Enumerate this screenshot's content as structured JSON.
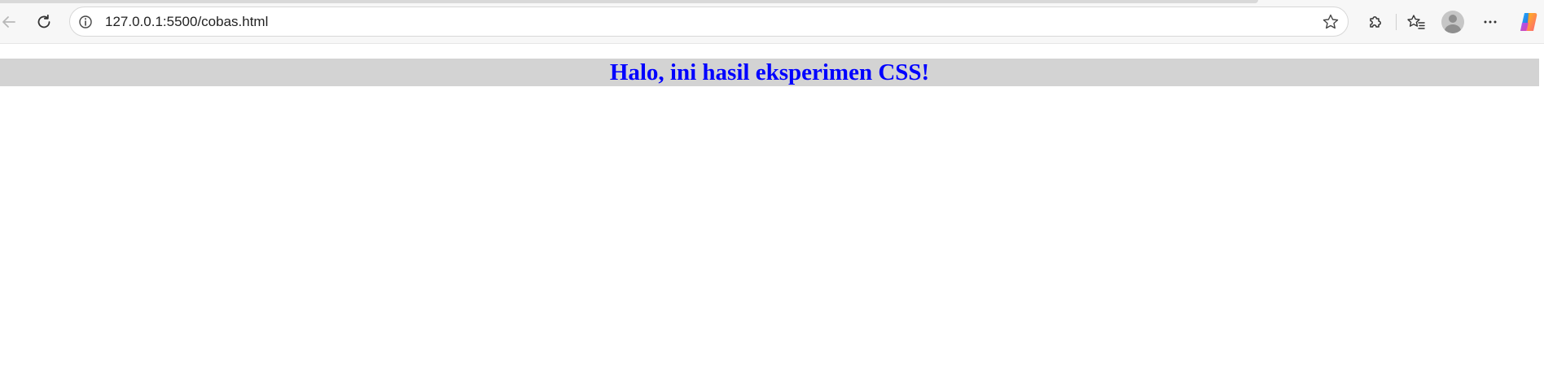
{
  "browser": {
    "address_bar": {
      "url": "127.0.0.1:5500/cobas.html"
    },
    "toolbar_icons": [
      "back-icon",
      "reload-icon",
      "info-icon",
      "star-icon",
      "extensions-icon",
      "favorites-icon",
      "profile-icon",
      "more-icon",
      "copilot-icon"
    ]
  },
  "page": {
    "heading": "Halo, ini hasil eksperimen CSS!",
    "heading_color": "#0000ff",
    "heading_background": "#d3d3d3"
  }
}
